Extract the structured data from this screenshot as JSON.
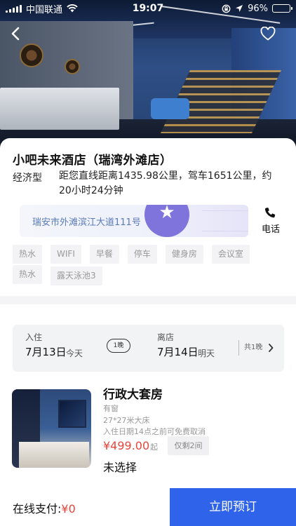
{
  "status_bar": {
    "carrier": "中国联通",
    "time": "19:07",
    "battery": "96%",
    "battery_level": 0.96
  },
  "hotel": {
    "name": "小吧未来酒店（瑞湾外滩店）",
    "type": "经济型",
    "distance": "距您直线距离1435.98公里，驾车1651公里，约20小时24分钟",
    "address": "瑞安市外滩滨江大道111号",
    "phone_label": "电话",
    "facilities": [
      "热水",
      "WIFI",
      "早餐",
      "停车",
      "健身房",
      "会议室",
      "热水",
      "露天泳池3"
    ]
  },
  "dates": {
    "checkin_label": "入住",
    "checkin_date": "7月13日",
    "checkin_sub": "今天",
    "nights": "1晚",
    "checkout_label": "离店",
    "checkout_date": "7月14日",
    "checkout_sub": "明天",
    "total_nights": "共1晚"
  },
  "room": {
    "name": "行政大套房",
    "window": "有窗",
    "bed": "27*27米大床",
    "policy": "入住日期14点之前可免费取消",
    "price": "¥499.00",
    "price_suffix": "起",
    "remaining": "仅剩2间",
    "selection": "未选择"
  },
  "footer": {
    "pay_label": "在线支付:",
    "pay_amount": "¥0",
    "book_button": "立即预订"
  },
  "colors": {
    "accent": "#2f63ea",
    "price": "#e8453a",
    "map_pin": "#6b5fd6"
  }
}
